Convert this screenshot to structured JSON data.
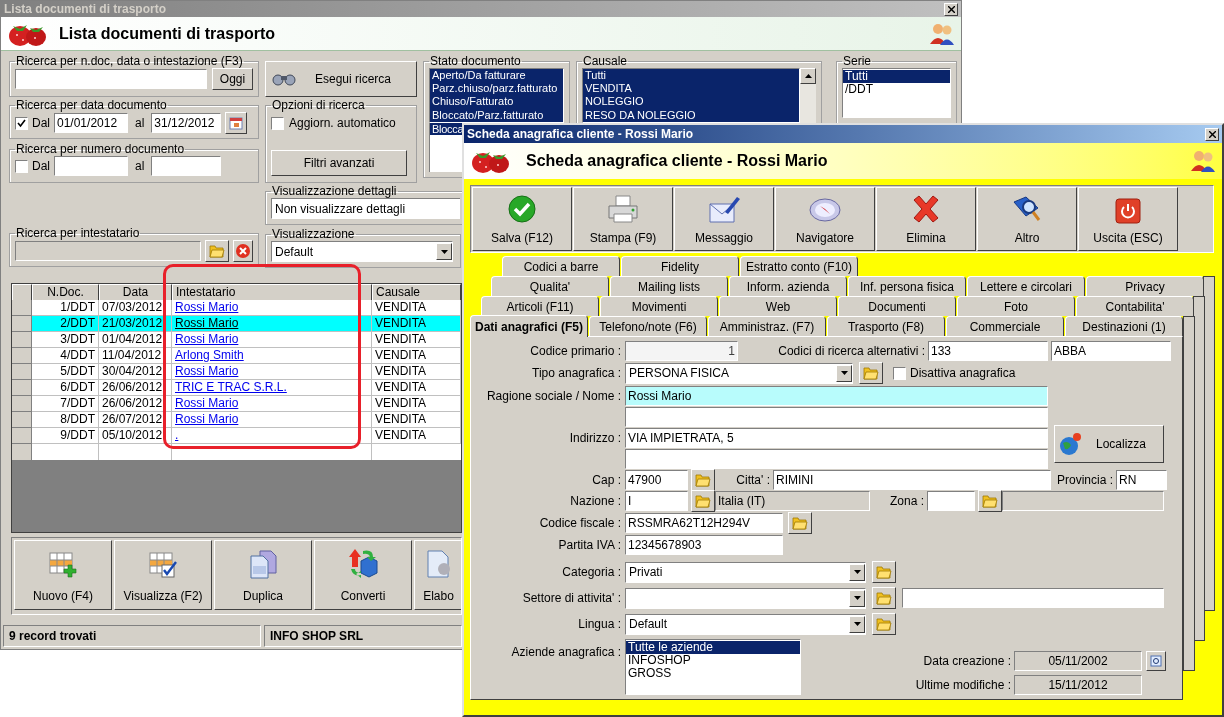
{
  "list_window": {
    "title": "Lista documenti di trasporto",
    "heading": "Lista documenti di trasporto",
    "quick_search": {
      "label": "Ricerca per n.doc, data o intestazione (F3)",
      "today_button": "Oggi"
    },
    "search_button": "Esegui ricerca",
    "date_search": {
      "label": "Ricerca per data documento",
      "checked": true,
      "from_label": "Dal",
      "from": "01/01/2012",
      "to_label": "al",
      "to": "31/12/2012"
    },
    "number_search": {
      "label": "Ricerca per numero documento",
      "checked": false,
      "from_label": "Dal",
      "to_label": "al"
    },
    "search_options": {
      "label": "Opzioni di ricerca",
      "auto_update": {
        "label": "Aggiorn. automatico",
        "checked": false
      },
      "advanced_button": "Filtri avanzati"
    },
    "status_filter": {
      "label": "Stato documento",
      "items": [
        {
          "label": "Aperto/Da fatturare",
          "selected": true
        },
        {
          "label": "Parz.chiuso/parz.fatturato",
          "selected": true
        },
        {
          "label": "Chiuso/Fatturato",
          "selected": true
        },
        {
          "label": "Bloccato/Parz.fatturato",
          "selected": true
        },
        {
          "label": "Blocca",
          "selected": true
        }
      ]
    },
    "reason_filter": {
      "label": "Causale",
      "items": [
        {
          "label": "Tutti",
          "selected": true
        },
        {
          "label": "VENDITA",
          "selected": true
        },
        {
          "label": "NOLEGGIO",
          "selected": true
        },
        {
          "label": "RESO DA NOLEGGIO",
          "selected": true
        }
      ]
    },
    "series_filter": {
      "label": "Serie",
      "items": [
        {
          "label": "Tutti",
          "selected": true
        },
        {
          "label": "/DDT",
          "selected": false
        }
      ]
    },
    "detail_view": {
      "label": "Visualizzazione dettagli",
      "value": "Non visualizzare dettagli"
    },
    "holder_search": {
      "label": "Ricerca per intestatario"
    },
    "view": {
      "label": "Visualizzazione",
      "value": "Default"
    },
    "table": {
      "columns": [
        "N.Doc.",
        "Data",
        "Intestatario",
        "Causale"
      ],
      "rows": [
        {
          "cells": [
            "1/DDT",
            "07/03/2012",
            "Rossi Mario",
            "VENDITA"
          ],
          "selected": false
        },
        {
          "cells": [
            "2/DDT",
            "21/03/2012",
            "Rossi Mario",
            "VENDITA"
          ],
          "selected": true
        },
        {
          "cells": [
            "3/DDT",
            "01/04/2012",
            "Rossi Mario",
            "VENDITA"
          ],
          "selected": false
        },
        {
          "cells": [
            "4/DDT",
            "11/04/2012",
            "Arlong Smith",
            "VENDITA"
          ],
          "selected": false
        },
        {
          "cells": [
            "5/DDT",
            "30/04/2012",
            "Rossi Mario",
            "VENDITA"
          ],
          "selected": false
        },
        {
          "cells": [
            "6/DDT",
            "26/06/2012",
            "TRIC E TRAC S.R.L.",
            "VENDITA"
          ],
          "selected": false
        },
        {
          "cells": [
            "7/DDT",
            "26/06/2012",
            "Rossi Mario",
            "VENDITA"
          ],
          "selected": false
        },
        {
          "cells": [
            "8/DDT",
            "26/07/2012",
            "Rossi Mario",
            "VENDITA"
          ],
          "selected": false
        },
        {
          "cells": [
            "9/DDT",
            "05/10/2012",
            ".",
            "VENDITA"
          ],
          "selected": false
        }
      ]
    },
    "toolbar": [
      "Nuovo (F4)",
      "Visualizza (F2)",
      "Duplica",
      "Converti",
      "Elabo"
    ],
    "status_bar": [
      "9 record trovati",
      "INFO SHOP SRL"
    ]
  },
  "customer_window": {
    "title": "Scheda anagrafica cliente - Rossi Mario",
    "heading": "Scheda anagrafica cliente - Rossi Mario",
    "toolbar": [
      "Salva (F12)",
      "Stampa (F9)",
      "Messaggio",
      "Navigatore",
      "Elimina",
      "Altro",
      "Uscita (ESC)"
    ],
    "tab_rows": [
      [
        {
          "label": "Codici a barre",
          "selected": false
        },
        {
          "label": "Fidelity",
          "selected": false
        },
        {
          "label": "Estratto conto (F10)",
          "selected": false
        }
      ],
      [
        {
          "label": "Qualita'",
          "selected": false
        },
        {
          "label": "Mailing lists",
          "selected": false
        },
        {
          "label": "Inform. azienda",
          "selected": false
        },
        {
          "label": "Inf. persona fisica",
          "selected": false
        },
        {
          "label": "Lettere e circolari",
          "selected": false
        },
        {
          "label": "Privacy",
          "selected": false
        }
      ],
      [
        {
          "label": "Articoli (F11)",
          "selected": false
        },
        {
          "label": "Movimenti",
          "selected": false
        },
        {
          "label": "Web",
          "selected": false
        },
        {
          "label": "Documenti",
          "selected": false
        },
        {
          "label": "Foto",
          "selected": false
        },
        {
          "label": "Contabilita'",
          "selected": false
        }
      ],
      [
        {
          "label": "Dati anagrafici (F5)",
          "selected": true
        },
        {
          "label": "Telefono/note (F6)",
          "selected": false
        },
        {
          "label": "Amministraz. (F7)",
          "selected": false
        },
        {
          "label": "Trasporto (F8)",
          "selected": false
        },
        {
          "label": "Commerciale",
          "selected": false
        },
        {
          "label": "Destinazioni (1)",
          "selected": false
        }
      ]
    ],
    "form": {
      "primary_code": {
        "label": "Codice primario :",
        "value": "1"
      },
      "alt_codes": {
        "label": "Codici di ricerca alternativi :",
        "values": [
          "133",
          "ABBA"
        ]
      },
      "type": {
        "label": "Tipo anagrafica :",
        "value": "PERSONA FISICA"
      },
      "deactivate": {
        "label": "Disattiva anagrafica",
        "checked": false
      },
      "name": {
        "label": "Ragione sociale / Nome :",
        "value": "Rossi Mario",
        "focused": true
      },
      "address": {
        "label": "Indirizzo :",
        "value": "VIA IMPIETRATA, 5"
      },
      "locate_button": "Localizza",
      "cap": {
        "label": "Cap :",
        "value": "47900"
      },
      "city": {
        "label": "Citta' :",
        "value": "RIMINI"
      },
      "province": {
        "label": "Provincia :",
        "value": "RN"
      },
      "country": {
        "label": "Nazione :",
        "value": "I",
        "name": "Italia (IT)"
      },
      "zone": {
        "label": "Zona :"
      },
      "tax_code": {
        "label": "Codice fiscale :",
        "value": "RSSMRA62T12H294V"
      },
      "vat": {
        "label": "Partita IVA :",
        "value": "12345678903"
      },
      "category": {
        "label": "Categoria :",
        "value": "Privati"
      },
      "sector": {
        "label": "Settore di attivita' :"
      },
      "language": {
        "label": "Lingua :",
        "value": "Default"
      },
      "companies": {
        "label": "Aziende anagrafica :",
        "items": [
          {
            "label": "Tutte le aziende",
            "selected": true
          },
          {
            "label": "INFOSHOP",
            "selected": false
          },
          {
            "label": "GROSS",
            "selected": false
          }
        ]
      },
      "created": {
        "label": "Data creazione :",
        "value": "05/11/2002"
      },
      "modified": {
        "label": "Ultime modifiche :",
        "value": "15/11/2012"
      }
    }
  }
}
